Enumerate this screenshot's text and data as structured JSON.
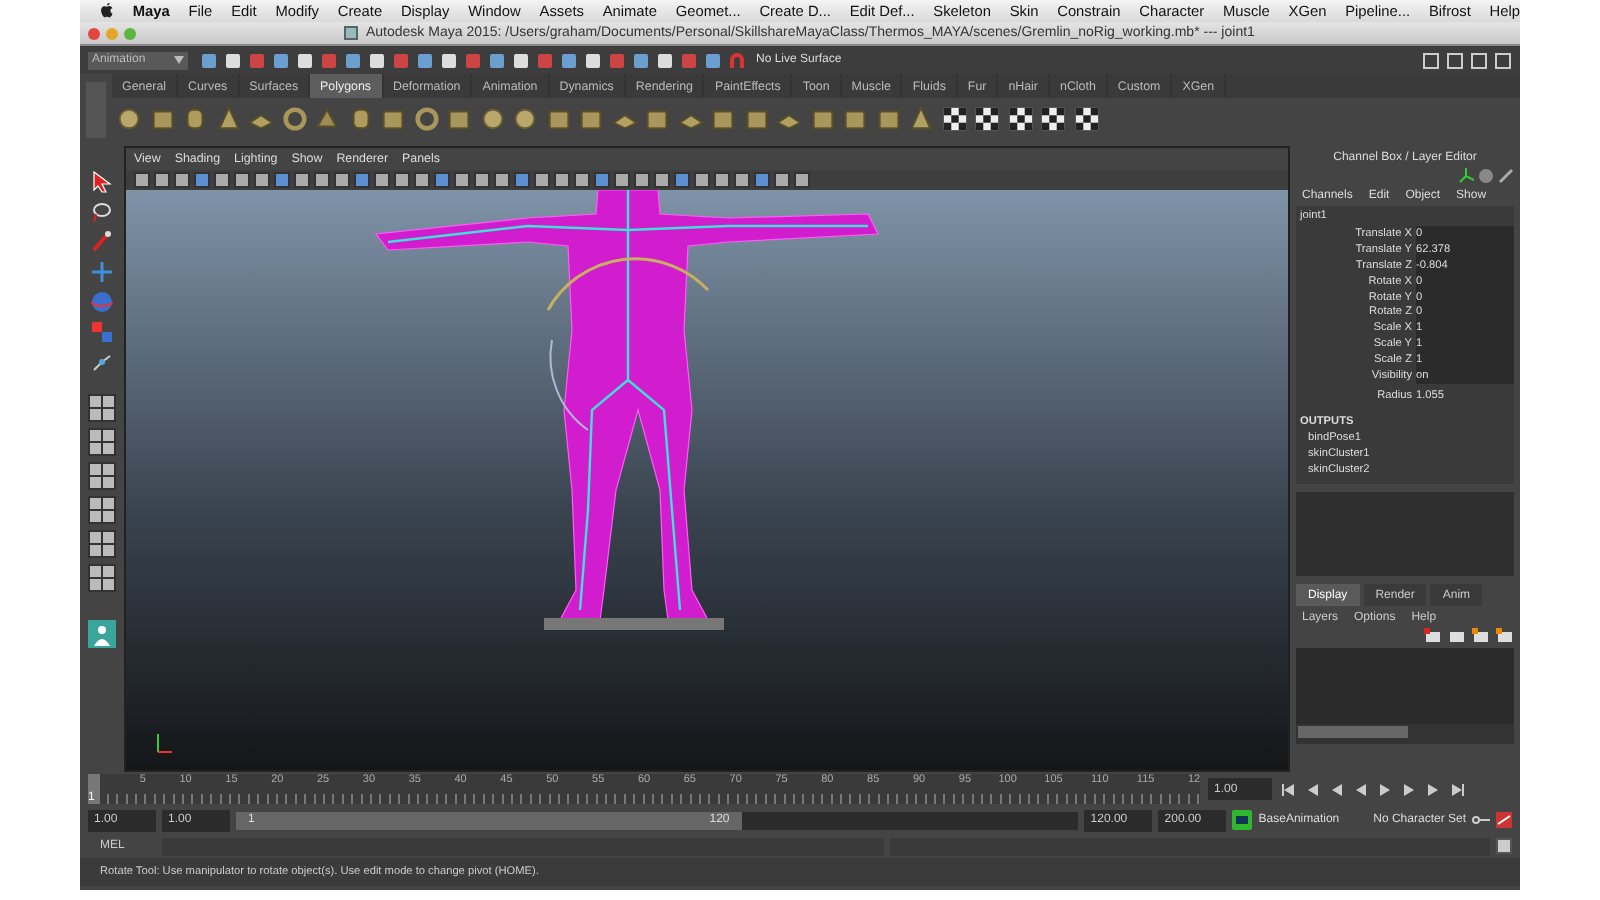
{
  "menu_bar": {
    "app": "Maya",
    "items": [
      "File",
      "Edit",
      "Modify",
      "Create",
      "Display",
      "Window",
      "Assets",
      "Animate",
      "Geomet...",
      "Create D...",
      "Edit Def...",
      "Skeleton",
      "Skin",
      "Constrain",
      "Character",
      "Muscle",
      "XGen",
      "Pipeline...",
      "Bifrost",
      "Help"
    ]
  },
  "title_bar": {
    "title": "Autodesk Maya 2015: /Users/graham/Documents/Personal/SkillshareMayaClass/Thermos_MAYA/scenes/Gremlin_noRig_working.mb*  ---  joint1"
  },
  "status_line": {
    "mode": "Animation",
    "live_surface": "No Live Surface"
  },
  "shelf_tabs": [
    {
      "label": "General",
      "selected": false
    },
    {
      "label": "Curves",
      "selected": false
    },
    {
      "label": "Surfaces",
      "selected": false
    },
    {
      "label": "Polygons",
      "selected": true
    },
    {
      "label": "Deformation",
      "selected": false
    },
    {
      "label": "Animation",
      "selected": false
    },
    {
      "label": "Dynamics",
      "selected": false
    },
    {
      "label": "Rendering",
      "selected": false
    },
    {
      "label": "PaintEffects",
      "selected": false
    },
    {
      "label": "Toon",
      "selected": false
    },
    {
      "label": "Muscle",
      "selected": false
    },
    {
      "label": "Fluids",
      "selected": false
    },
    {
      "label": "Fur",
      "selected": false
    },
    {
      "label": "nHair",
      "selected": false
    },
    {
      "label": "nCloth",
      "selected": false
    },
    {
      "label": "Custom",
      "selected": false
    },
    {
      "label": "XGen",
      "selected": false
    }
  ],
  "viewport": {
    "menus": [
      "View",
      "Shading",
      "Lighting",
      "Show",
      "Renderer",
      "Panels"
    ]
  },
  "channel_box": {
    "title": "Channel Box / Layer Editor",
    "menus": [
      "Channels",
      "Edit",
      "Object",
      "Show"
    ],
    "object": "joint1",
    "channels": [
      {
        "name": "Translate X",
        "value": "0"
      },
      {
        "name": "Translate Y",
        "value": "62.378"
      },
      {
        "name": "Translate Z",
        "value": "-0.804"
      },
      {
        "name": "Rotate X",
        "value": "0"
      },
      {
        "name": "Rotate Y",
        "value": "0"
      },
      {
        "name": "Rotate Z",
        "value": "0"
      },
      {
        "name": "Scale X",
        "value": "1"
      },
      {
        "name": "Scale Y",
        "value": "1"
      },
      {
        "name": "Scale Z",
        "value": "1"
      },
      {
        "name": "Visibility",
        "value": "on"
      }
    ],
    "shape_channels": [
      {
        "name": "Radius",
        "value": "1.055"
      }
    ],
    "outputs_label": "OUTPUTS",
    "outputs": [
      "bindPose1",
      "skinCluster1",
      "skinCluster2"
    ]
  },
  "layer_editor": {
    "tabs": [
      {
        "label": "Display",
        "selected": true
      },
      {
        "label": "Render",
        "selected": false
      },
      {
        "label": "Anim",
        "selected": false
      }
    ],
    "menus": [
      "Layers",
      "Options",
      "Help"
    ]
  },
  "time_slider": {
    "ticks": [
      "5",
      "10",
      "15",
      "20",
      "25",
      "30",
      "35",
      "40",
      "45",
      "50",
      "55",
      "60",
      "65",
      "70",
      "75",
      "80",
      "85",
      "90",
      "95",
      "100",
      "105",
      "110",
      "115",
      "12"
    ],
    "current_marker": "1",
    "level": 0,
    "current_frame": "1.00"
  },
  "range_slider": {
    "start": "1.00",
    "playback_start": "1.00",
    "range_start": "1",
    "range_end": "120",
    "playback_end": "120.00",
    "end": "200.00",
    "anim_layer": "BaseAnimation",
    "character_set": "No Character Set"
  },
  "command_line": {
    "label": "MEL"
  },
  "help_line": {
    "text": "Rotate Tool: Use manipulator to rotate object(s). Use edit mode to change pivot (HOME)."
  }
}
